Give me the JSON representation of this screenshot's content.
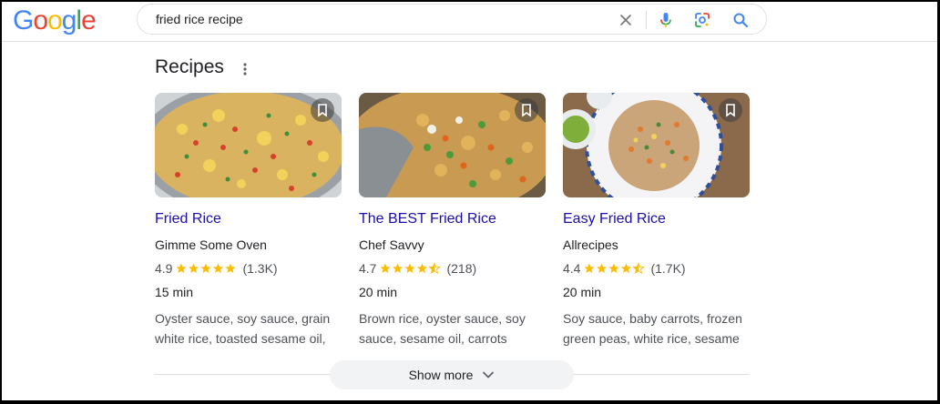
{
  "header": {
    "logo_letters": [
      "G",
      "o",
      "o",
      "g",
      "l",
      "e"
    ],
    "logo_colors": [
      "#4285F4",
      "#EA4335",
      "#FBBC05",
      "#4285F4",
      "#34A853",
      "#EA4335"
    ],
    "search_query": "fried rice recipe",
    "icons": [
      "close-icon",
      "microphone-icon",
      "lens-icon",
      "search-icon"
    ]
  },
  "section": {
    "heading": "Recipes",
    "menu_icon": "more-vert-icon"
  },
  "recipes": [
    {
      "title": "Fried Rice",
      "source": "Gimme Some Oven",
      "rating": "4.9",
      "stars": 5,
      "reviews": "(1.3K)",
      "time": "15 min",
      "ingredients": "Oyster sauce, soy sauce, grain white rice, toasted sesame oil,"
    },
    {
      "title": "The BEST Fried Rice",
      "source": "Chef Savvy",
      "rating": "4.7",
      "stars": 4.5,
      "reviews": "(218)",
      "time": "20 min",
      "ingredients": "Brown rice, oyster sauce, soy sauce, sesame oil, carrots"
    },
    {
      "title": "Easy Fried Rice",
      "source": "Allrecipes",
      "rating": "4.4",
      "stars": 4.5,
      "reviews": "(1.7K)",
      "time": "20 min",
      "ingredients": "Soy sauce, baby carrots, frozen green peas, white rice, sesame"
    }
  ],
  "footer": {
    "show_more_label": "Show more"
  },
  "colors": {
    "link": "#1a0dab",
    "star": "#fbbc04",
    "show_more_bg": "#f1f3f4"
  }
}
